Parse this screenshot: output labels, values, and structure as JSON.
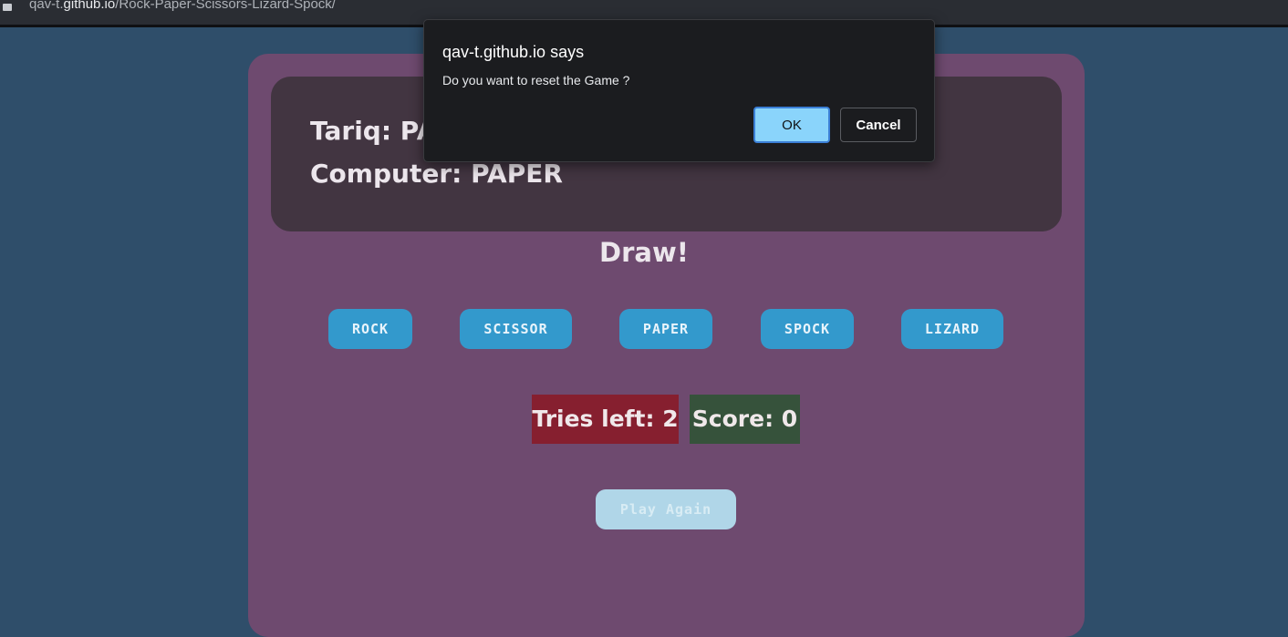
{
  "browser": {
    "url_prefix": "qav-t.",
    "url_host": "github.io",
    "url_path": "/Rock-Paper-Scissors-Lizard-Spock/"
  },
  "game": {
    "player_line": "Tariq: PA",
    "computer_line": "Computer: PAPER",
    "result": "Draw!",
    "moves": {
      "rock": "ROCK",
      "scissor": "SCISSOR",
      "paper": "PAPER",
      "spock": "SPOCK",
      "lizard": "LIZARD"
    },
    "tries_left": "Tries left: 2",
    "score": "Score: 0",
    "play_again": "Play Again"
  },
  "dialog": {
    "title": "qav-t.github.io says",
    "message": "Do you want to reset the Game ?",
    "ok": "OK",
    "cancel": "Cancel"
  },
  "colors": {
    "background": "#2f4e6a",
    "card": "#6e4a6f",
    "move_button": "#3399cc",
    "tries_badge": "#861f2f",
    "score_badge": "#36523b"
  }
}
